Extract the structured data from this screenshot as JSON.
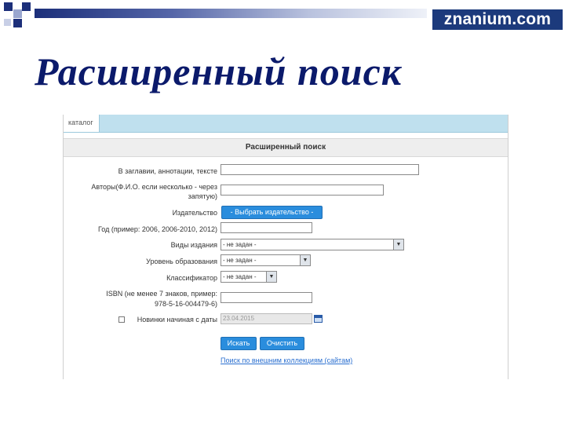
{
  "slide": {
    "title": "Расширенный поиск",
    "logo": "znanium.com"
  },
  "app": {
    "tab_label": "каталог",
    "panel_title": "Расширенный поиск"
  },
  "form": {
    "labels": {
      "title_words": "В заглавии, аннотации, тексте",
      "authors_line1": "Авторы(Ф.И.О. если несколько - через",
      "authors_line2": "запятую)",
      "publisher": "Издательство",
      "year": "Год (пример: 2006, 2006-2010, 2012)",
      "edition_types": "Виды издания",
      "education_level": "Уровень образования",
      "classifier": "Классификатор",
      "isbn_line1": "ISBN (не менее 7 знаков, пример:",
      "isbn_line2": "978-5-16-004479-6)",
      "new_from": "Новинки начиная с даты"
    },
    "publisher_button": "- Выбрать издательство -",
    "edition_types_value": "- не задан -",
    "education_level_value": "- не задан -",
    "classifier_value": "- не задан -",
    "date_value": "23.04.2015",
    "search_button": "Искать",
    "clear_button": "Очистить",
    "collection_link": "Поиск по внешним коллекциям (сайтам)"
  },
  "colors": {
    "title": "#0b1a6b",
    "logo_bg": "#1c3a7c",
    "button": "#2a8ddd",
    "tabbar": "#bfe0ee"
  }
}
